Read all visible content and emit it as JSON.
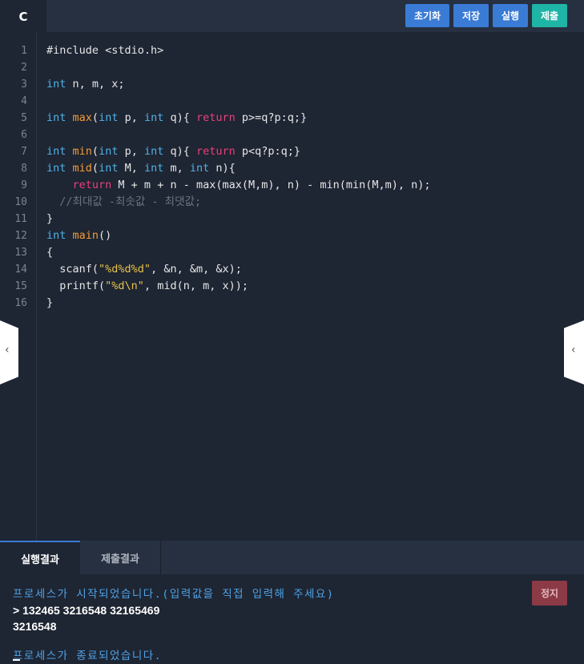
{
  "editor_tab": {
    "language": "C"
  },
  "toolbar": {
    "reset_label": "초기화",
    "save_label": "저장",
    "run_label": "실행",
    "submit_label": "제출"
  },
  "code": {
    "line_numbers": [
      "1",
      "2",
      "3",
      "4",
      "5",
      "6",
      "7",
      "8",
      "9",
      "10",
      "11",
      "12",
      "13",
      "14",
      "15",
      "16"
    ],
    "lines": [
      [
        {
          "t": "#include <stdio.h>",
          "c": ""
        }
      ],
      [],
      [
        {
          "t": "int",
          "c": "kw"
        },
        {
          "t": " n, m, x;",
          "c": ""
        }
      ],
      [],
      [
        {
          "t": "int",
          "c": "kw"
        },
        {
          "t": " ",
          "c": ""
        },
        {
          "t": "max",
          "c": "fn"
        },
        {
          "t": "(",
          "c": ""
        },
        {
          "t": "int",
          "c": "kw"
        },
        {
          "t": " p, ",
          "c": ""
        },
        {
          "t": "int",
          "c": "kw"
        },
        {
          "t": " q){ ",
          "c": ""
        },
        {
          "t": "return",
          "c": "kr"
        },
        {
          "t": " p>=q?p:q;}",
          "c": ""
        }
      ],
      [],
      [
        {
          "t": "int",
          "c": "kw"
        },
        {
          "t": " ",
          "c": ""
        },
        {
          "t": "min",
          "c": "fn"
        },
        {
          "t": "(",
          "c": ""
        },
        {
          "t": "int",
          "c": "kw"
        },
        {
          "t": " p, ",
          "c": ""
        },
        {
          "t": "int",
          "c": "kw"
        },
        {
          "t": " q){ ",
          "c": ""
        },
        {
          "t": "return",
          "c": "kr"
        },
        {
          "t": " p<q?p:q;}",
          "c": ""
        }
      ],
      [
        {
          "t": "int",
          "c": "kw"
        },
        {
          "t": " ",
          "c": ""
        },
        {
          "t": "mid",
          "c": "fn"
        },
        {
          "t": "(",
          "c": ""
        },
        {
          "t": "int",
          "c": "kw"
        },
        {
          "t": " M, ",
          "c": ""
        },
        {
          "t": "int",
          "c": "kw"
        },
        {
          "t": " m, ",
          "c": ""
        },
        {
          "t": "int",
          "c": "kw"
        },
        {
          "t": " n){",
          "c": ""
        }
      ],
      [
        {
          "t": "    ",
          "c": ""
        },
        {
          "t": "return",
          "c": "kr"
        },
        {
          "t": " M + m + n - max(max(M,m), n) - min(min(M,m), n);",
          "c": ""
        }
      ],
      [
        {
          "t": "  ",
          "c": ""
        },
        {
          "t": "//최대값 -최솟값 - 최댓값;",
          "c": "cm"
        }
      ],
      [
        {
          "t": "}",
          "c": ""
        }
      ],
      [
        {
          "t": "int",
          "c": "kw"
        },
        {
          "t": " ",
          "c": ""
        },
        {
          "t": "main",
          "c": "fn"
        },
        {
          "t": "()",
          "c": ""
        }
      ],
      [
        {
          "t": "{",
          "c": ""
        }
      ],
      [
        {
          "t": "  scanf(",
          "c": ""
        },
        {
          "t": "\"%d%d%d\"",
          "c": "st"
        },
        {
          "t": ", &n, &m, &x);",
          "c": ""
        }
      ],
      [
        {
          "t": "  printf(",
          "c": ""
        },
        {
          "t": "\"%d\\n\"",
          "c": "st"
        },
        {
          "t": ", mid(n, m, x));",
          "c": ""
        }
      ],
      [
        {
          "t": "}",
          "c": ""
        }
      ]
    ]
  },
  "handles": {
    "left_glyph": "‹",
    "right_glyph": "‹"
  },
  "bottom_tabs": {
    "result_label": "실행결과",
    "submit_result_label": "제출결과"
  },
  "console": {
    "stop_label": "정지",
    "process_started": "프로세스가 시작되었습니다.(입력값을 직접 입력해 주세요)",
    "input_line": "> 132465 3216548 32165469",
    "output_line": "3216548",
    "process_ended": "프로세스가 종료되었습니다."
  },
  "colors": {
    "accent_blue": "#3a7bd5",
    "submit_teal": "#1fb5a6",
    "stop_red": "#8c3a45",
    "keyword": "#4fb3e6",
    "return_keyword": "#e8417a",
    "function": "#f29b38",
    "string": "#e6c34a"
  }
}
